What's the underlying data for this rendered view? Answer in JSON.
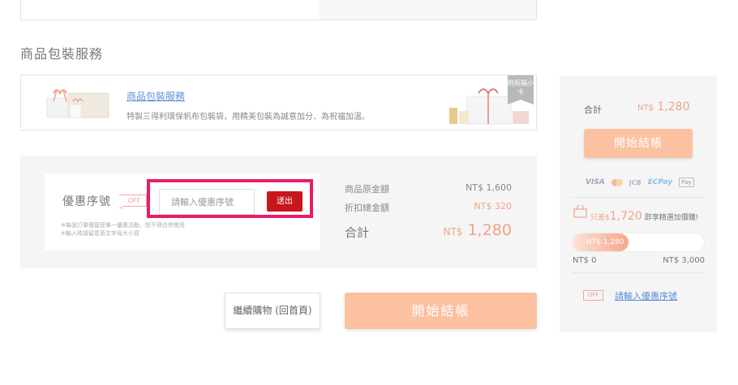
{
  "section": {
    "title": "商品包裝服務"
  },
  "wrap_service": {
    "link": "商品包裝服務",
    "description": "特製三得利環保帆布包裝袋，用精美包裝為誠意加分、為祝福加溫。",
    "tag": "附祝福小卡"
  },
  "coupon": {
    "label": "優惠序號",
    "off_tag": "OFF",
    "placeholder": "請輸入優惠序號",
    "send_label": "送出",
    "notes": [
      "※每張訂單僅接受單一優惠活動，恕不得合併使用",
      "※輸入時請留意英文字母大小寫"
    ]
  },
  "prices": {
    "original_label": "商品原金額",
    "original_value": "NT$ 1,600",
    "discount_label": "折扣總金額",
    "discount_value": "NT$ 320",
    "total_label": "合計",
    "total_currency": "NT$",
    "total_value": "1,280"
  },
  "actions": {
    "continue_label": "繼續購物 (回首頁)",
    "checkout_label": "開始結帳"
  },
  "sidebar": {
    "total_label": "合計",
    "total_currency": "NT$",
    "total_value": "1,280",
    "checkout_label": "開始結帳",
    "payments": {
      "visa": "VISA",
      "jcb": "JCB",
      "ecpay": "ECPay",
      "applepay": "Pay"
    },
    "promo_prefix": "只差$",
    "promo_amount": "1,720",
    "promo_suffix": "即享精選加價購!",
    "bag_label": "優惠",
    "progress_label": "NT$ 1,280",
    "progress_fraction": 0.4267,
    "progress_min": "NT$ 0",
    "progress_max": "NT$ 3,000",
    "off_tag": "OFF",
    "coupon_link": "請輸入優惠序號"
  },
  "colors": {
    "accent": "#f3a286",
    "button": "#fcc1a1",
    "send": "#c8161d",
    "highlight": "#ea1c69",
    "link": "#5b8fd8"
  }
}
